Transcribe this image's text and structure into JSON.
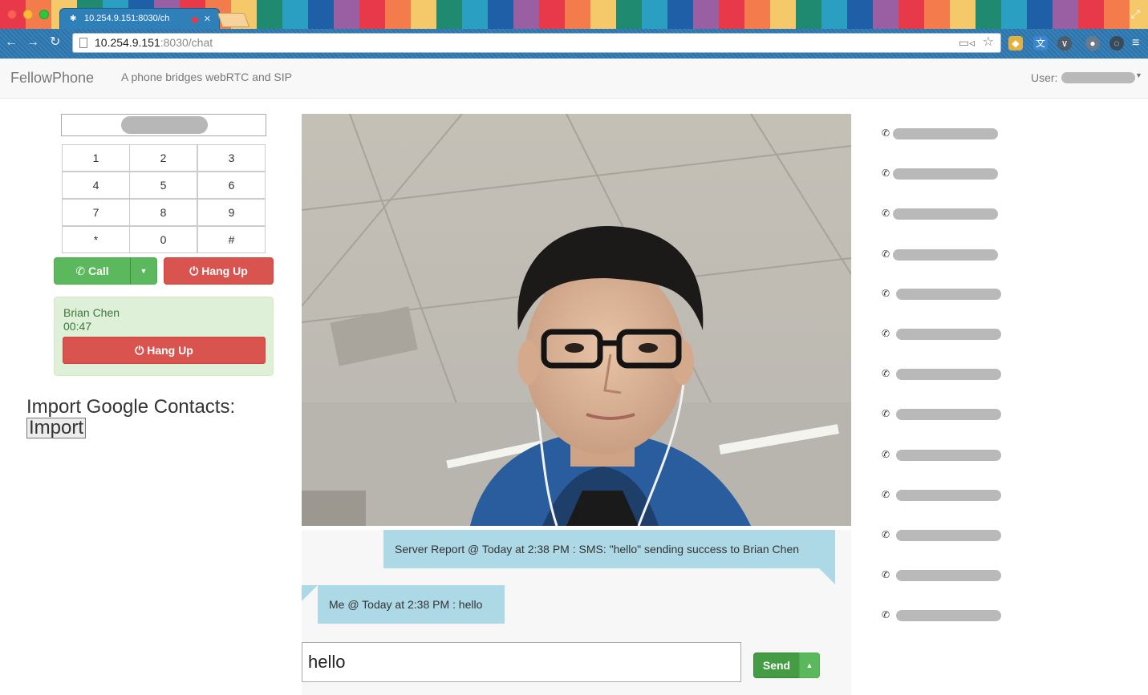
{
  "browser": {
    "tab_title": "10.254.9.151:8030/ch",
    "url_host": "10.254.9.151",
    "url_rest": ":8030/chat"
  },
  "navbar": {
    "brand": "FellowPhone",
    "tagline": "A phone bridges webRTC and SIP",
    "user_label": "User:"
  },
  "dialer": {
    "keys": [
      "1",
      "2",
      "3",
      "4",
      "5",
      "6",
      "7",
      "8",
      "9",
      "*",
      "0",
      "#"
    ],
    "call_label": "Call",
    "hangup_label": "Hang Up"
  },
  "active_call": {
    "name": "Brian Chen",
    "duration": "00:47",
    "hangup_label": "Hang Up"
  },
  "import": {
    "label": "Import Google Contacts:",
    "button_label": "Import"
  },
  "chat": {
    "messages": [
      {
        "text": "Server Report @ Today at 2:38 PM : SMS: \"hello\" sending success to Brian Chen"
      },
      {
        "text": "Me @ Today at 2:38 PM : hello"
      }
    ],
    "input_value": "hello",
    "send_label": "Send"
  },
  "contacts_count": 13,
  "icons": {
    "phone": "phone-icon",
    "power": "power-icon",
    "caret": "caret-down-icon"
  },
  "colors": {
    "success": "#5cb85c",
    "danger": "#d9534f",
    "bubble": "#add8e6",
    "call_panel": "#dff0d8"
  }
}
